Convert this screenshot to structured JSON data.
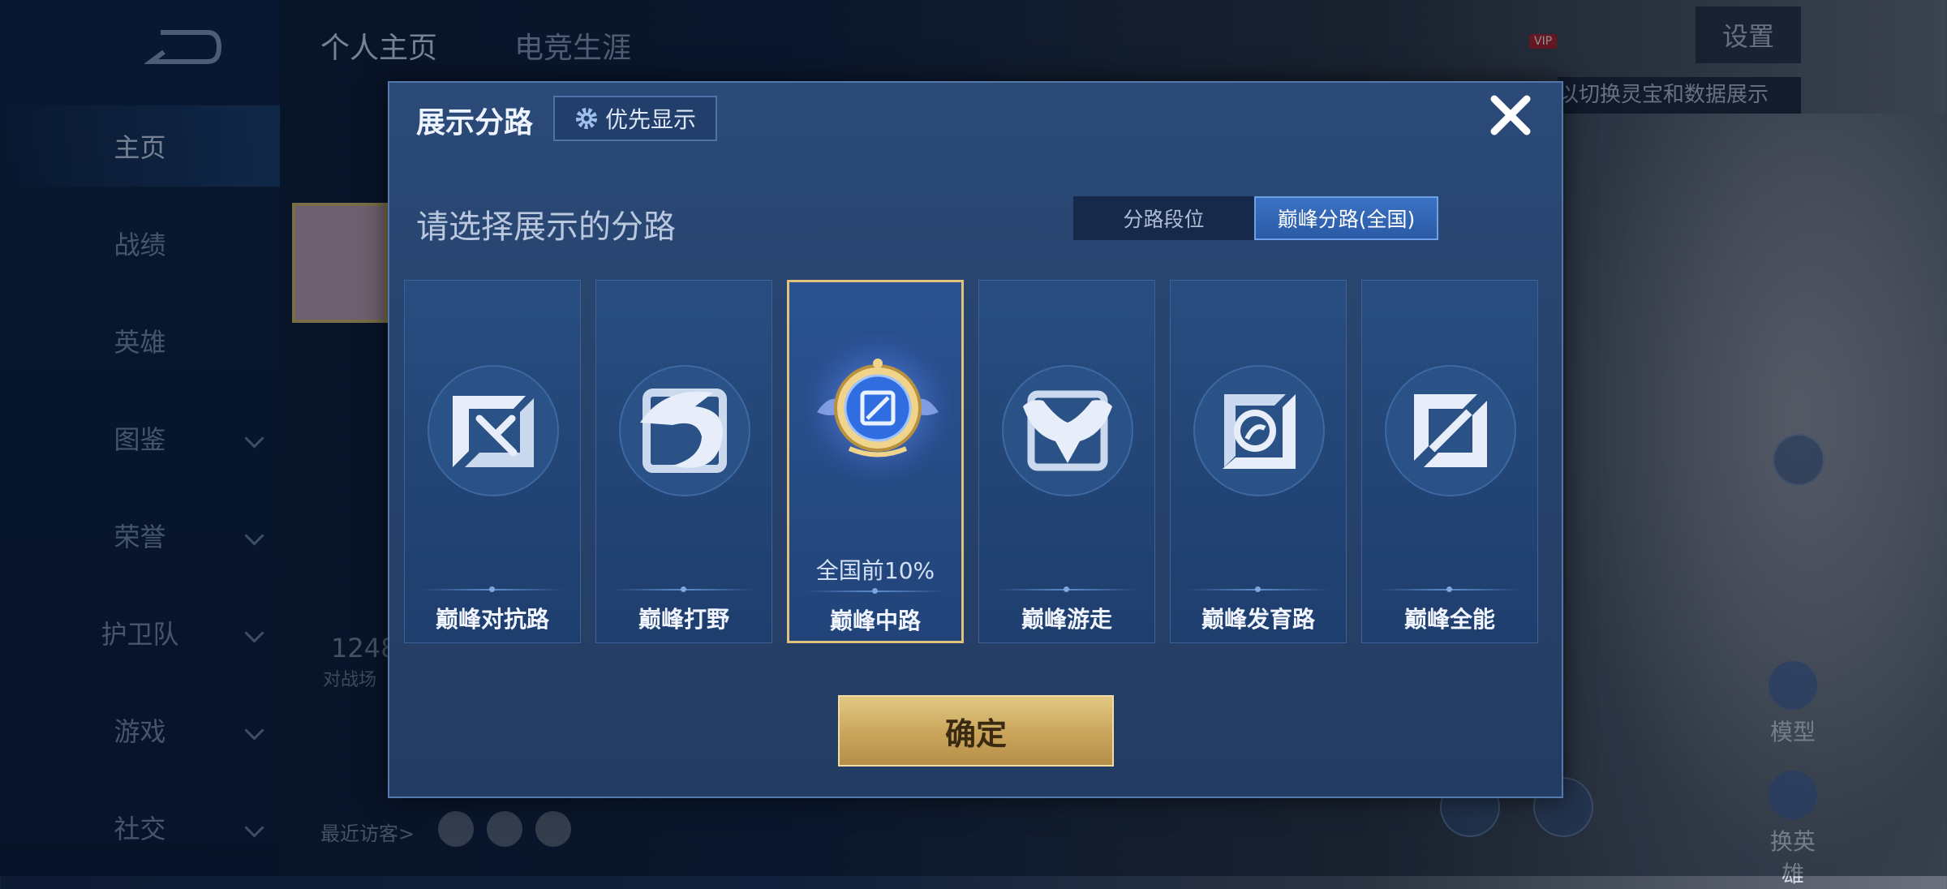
{
  "background": {
    "tabs": [
      "个人主页",
      "电竞生涯"
    ],
    "nav_items": [
      {
        "label": "主页",
        "active": true,
        "has_chevron": false
      },
      {
        "label": "战绩",
        "active": false,
        "has_chevron": false
      },
      {
        "label": "英雄",
        "active": false,
        "has_chevron": false
      },
      {
        "label": "图鉴",
        "active": false,
        "has_chevron": true
      },
      {
        "label": "荣誉",
        "active": false,
        "has_chevron": true
      },
      {
        "label": "护卫队",
        "active": false,
        "has_chevron": true
      },
      {
        "label": "游戏",
        "active": false,
        "has_chevron": true
      },
      {
        "label": "社交",
        "active": false,
        "has_chevron": true
      }
    ],
    "settings_label": "设置",
    "vip_label": "VIP",
    "hint_text": "以切换灵宝和数据展示",
    "side_buttons": {
      "model": "模型",
      "switch_hero": "换英雄"
    },
    "recent_visitors": "最近访客>",
    "stat_number": "1248",
    "stat_label": "对战场"
  },
  "modal": {
    "title": "展示分路",
    "priority_button": "优先显示",
    "subtitle": "请选择展示的分路",
    "toggle": {
      "options": [
        "分路段位",
        "巅峰分路(全国)"
      ],
      "selected": "巅峰分路(全国)"
    },
    "cards": [
      {
        "name": "巅峰对抗路",
        "icon": "clash-lane-icon",
        "selected": false,
        "rank": ""
      },
      {
        "name": "巅峰打野",
        "icon": "jungle-dragon-icon",
        "selected": false,
        "rank": ""
      },
      {
        "name": "巅峰中路",
        "icon": "mid-lane-gold-emblem-icon",
        "selected": true,
        "rank": "全国前10%"
      },
      {
        "name": "巅峰游走",
        "icon": "roam-wings-icon",
        "selected": false,
        "rank": ""
      },
      {
        "name": "巅峰发育路",
        "icon": "farm-lane-icon",
        "selected": false,
        "rank": ""
      },
      {
        "name": "巅峰全能",
        "icon": "all-round-icon",
        "selected": false,
        "rank": ""
      }
    ],
    "confirm_label": "确定"
  },
  "colors": {
    "accent_gold": "#e2c27a",
    "selected_toggle": "#3c72c4"
  }
}
